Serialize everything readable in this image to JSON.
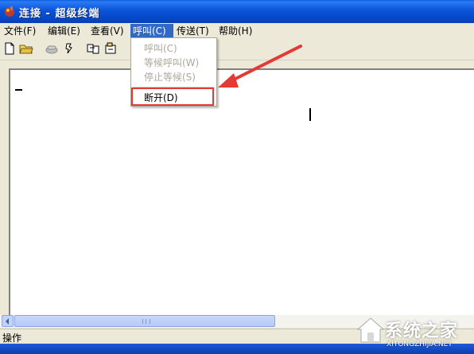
{
  "window": {
    "title": "连接 - 超级终端"
  },
  "menubar": {
    "items": [
      {
        "label": "文件(F)"
      },
      {
        "label": "编辑(E)"
      },
      {
        "label": "查看(V)"
      },
      {
        "label": "呼叫(C)",
        "active": true
      },
      {
        "label": "传送(T)"
      },
      {
        "label": "帮助(H)"
      }
    ]
  },
  "toolbar": {
    "icons": [
      "new-document-icon",
      "open-folder-icon",
      "call-icon",
      "disconnect-icon",
      "send-icon",
      "properties-icon"
    ]
  },
  "dropdown": {
    "items": [
      {
        "label": "呼叫(C)",
        "enabled": false
      },
      {
        "label": "等候呼叫(W)",
        "enabled": false
      },
      {
        "label": "停止等候(S)",
        "enabled": false
      },
      {
        "label": "断开(D)",
        "enabled": true
      }
    ]
  },
  "statusbar": {
    "text": "操作"
  },
  "watermark": {
    "text": "系统之家",
    "sub": "XITONGZHIJIA.NET"
  },
  "colors": {
    "title_bar": "#0a53d8",
    "menu_active": "#316ac5",
    "highlight": "#e53935"
  }
}
